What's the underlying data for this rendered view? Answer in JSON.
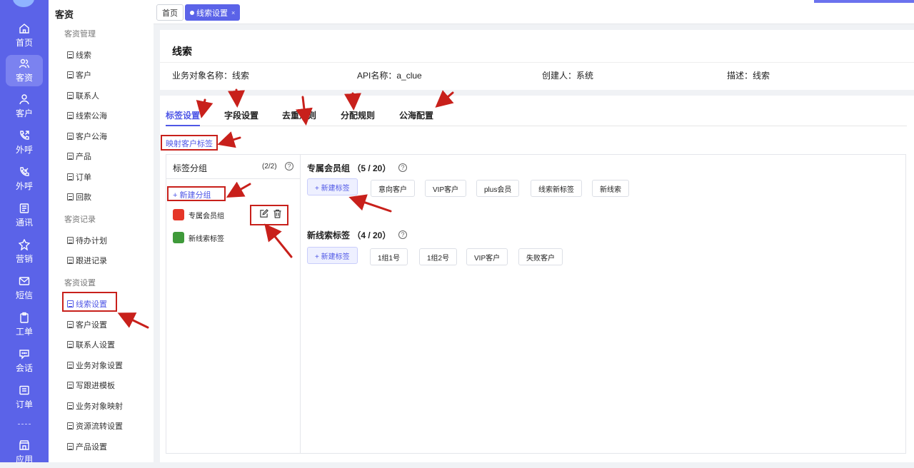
{
  "rail": {
    "items": [
      {
        "label": "首页",
        "icon": "home-icon"
      },
      {
        "label": "客资",
        "icon": "users-icon",
        "active": true
      },
      {
        "label": "客户",
        "icon": "user-icon"
      },
      {
        "label": "外呼",
        "icon": "phone-out-icon"
      },
      {
        "label": "外呼",
        "icon": "phone-in-icon"
      },
      {
        "label": "通讯",
        "icon": "address-book-icon"
      },
      {
        "label": "营销",
        "icon": "marketing-icon"
      },
      {
        "label": "短信",
        "icon": "sms-icon"
      },
      {
        "label": "工单",
        "icon": "clipboard-icon"
      },
      {
        "label": "会话",
        "icon": "chat-icon"
      },
      {
        "label": "订单",
        "icon": "order-icon"
      },
      {
        "label": "应用",
        "icon": "store-icon"
      }
    ]
  },
  "subbar": {
    "title": "客资",
    "sections": [
      {
        "title": "客资管理",
        "items": [
          "线索",
          "客户",
          "联系人",
          "线索公海",
          "客户公海",
          "产品",
          "订单",
          "回款"
        ]
      },
      {
        "title": "客资记录",
        "items": [
          "待办计划",
          "跟进记录"
        ]
      },
      {
        "title": "客资设置",
        "items": [
          "线索设置",
          "客户设置",
          "联系人设置",
          "业务对象设置",
          "写跟进模板",
          "业务对象映射",
          "资源流转设置",
          "产品设置"
        ]
      }
    ],
    "active_item": "线索设置"
  },
  "tabs": {
    "home": "首页",
    "current": "线索设置",
    "close": "×"
  },
  "info": {
    "title": "线索",
    "object_name": "业务对象名称：线索",
    "api_name": "API名称：a_clue",
    "creator": "创建人：系统",
    "description": "描述：线索"
  },
  "settings_tabs": [
    "标签设置",
    "字段设置",
    "去重规则",
    "分配规则",
    "公海配置"
  ],
  "map_link": "映射客户标签",
  "groups_panel": {
    "title": "标签分组",
    "count": "(2/2)",
    "help": "?",
    "new_group": "+ 新建分组",
    "groups": [
      {
        "name": "专属会员组",
        "color": "#e53628"
      },
      {
        "name": "新线索标签",
        "color": "#3f9a3a"
      }
    ]
  },
  "tag_groups": [
    {
      "title": "专属会员组 （5 / 20）",
      "add": "+ 新建标签",
      "tags": [
        "意向客户",
        "VIP客户",
        "plus会员",
        "线索新标签",
        "新线索"
      ]
    },
    {
      "title": "新线索标签 （4 / 20）",
      "add": "+ 新建标签",
      "tags": [
        "1组1号",
        "1组2号",
        "VIP客户",
        "失败客户"
      ]
    }
  ],
  "colors": {
    "accent": "#5b63e8",
    "annotation": "#c8201b"
  }
}
